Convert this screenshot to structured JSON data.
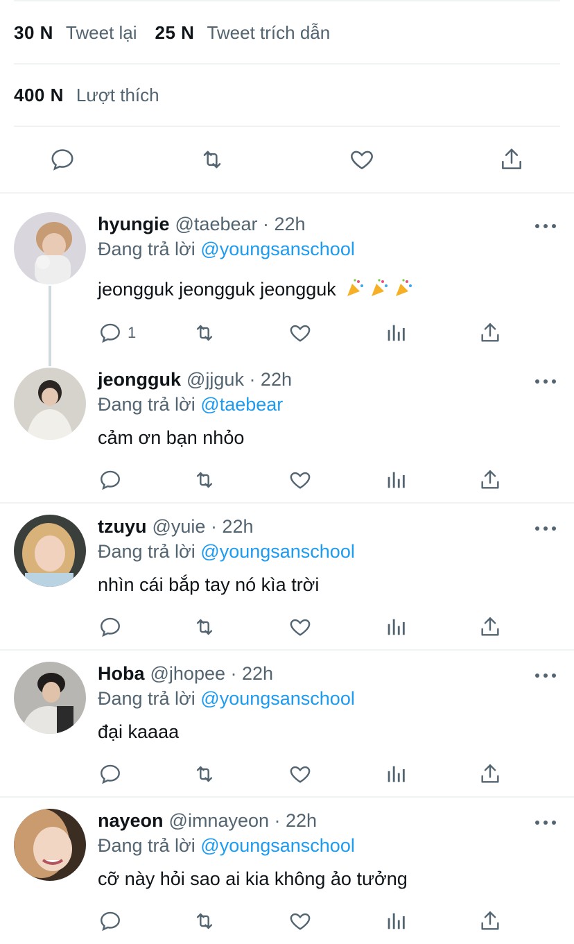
{
  "stats": {
    "retweets_count": "30 N",
    "retweets_label": "Tweet lại",
    "quotes_count": "25 N",
    "quotes_label": "Tweet trích dẫn",
    "likes_count": "400 N",
    "likes_label": "Lượt thích"
  },
  "colors": {
    "link": "#1d9bf0",
    "secondary": "#536471",
    "primary_text": "#0f1419",
    "divider": "#eff3f4"
  },
  "replying_prefix": "Đang trả lời",
  "replies": [
    {
      "name": "hyungie",
      "meta": "@taebear · 22h",
      "reply_to": "@youngsanschool",
      "text": "jeongguk jeongguk jeongguk",
      "emoji": "party-popper ×3",
      "reply_count": "1"
    },
    {
      "name": "jeongguk",
      "meta": "@jjguk · 22h",
      "reply_to": "@taebear",
      "text": "cảm ơn bạn nhỏo",
      "reply_count": ""
    },
    {
      "name": "tzuyu",
      "meta": "@yuie · 22h",
      "reply_to": "@youngsanschool",
      "text": "nhìn cái bắp tay nó kìa trời",
      "reply_count": ""
    },
    {
      "name": "Hoba",
      "meta": "@jhopee · 22h",
      "reply_to": "@youngsanschool",
      "text": "đại kaaaa",
      "reply_count": ""
    },
    {
      "name": "nayeon",
      "meta": "@imnayeon · 22h",
      "reply_to": "@youngsanschool",
      "text": "cỡ này hỏi sao ai kia không ảo tưởng",
      "reply_count": ""
    }
  ]
}
